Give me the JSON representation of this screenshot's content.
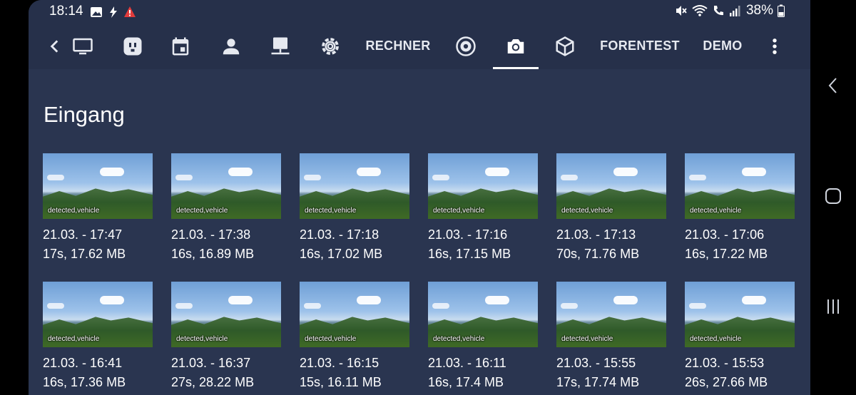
{
  "status": {
    "time": "18:14",
    "battery": "38%"
  },
  "tabs": [
    {
      "label": "",
      "icon": "back-chevron-icon"
    },
    {
      "label": "",
      "icon": "monitor-icon"
    },
    {
      "label": "",
      "icon": "socket-icon"
    },
    {
      "label": "",
      "icon": "calendar-icon"
    },
    {
      "label": "",
      "icon": "person-icon"
    },
    {
      "label": "",
      "icon": "network-icon"
    },
    {
      "label": "",
      "icon": "gear-icon"
    },
    {
      "label": "RECHNER",
      "icon": ""
    },
    {
      "label": "",
      "icon": "camera-dome-icon"
    },
    {
      "label": "",
      "icon": "camera-icon"
    },
    {
      "label": "",
      "icon": "box-icon"
    },
    {
      "label": "FORENTEST",
      "icon": ""
    },
    {
      "label": "DEMO",
      "icon": ""
    },
    {
      "label": "",
      "icon": "more-vertical-icon"
    }
  ],
  "section": {
    "title": "Eingang"
  },
  "recordings": [
    {
      "tag": "detected,vehicle",
      "time": "21.03. - 17:47",
      "info": "17s, 17.62 MB"
    },
    {
      "tag": "detected,vehicle",
      "time": "21.03. - 17:38",
      "info": "16s, 16.89 MB"
    },
    {
      "tag": "detected,vehicle",
      "time": "21.03. - 17:18",
      "info": "16s, 17.02 MB"
    },
    {
      "tag": "detected,vehicle",
      "time": "21.03. - 17:16",
      "info": "16s, 17.15 MB"
    },
    {
      "tag": "detected,vehicle",
      "time": "21.03. - 17:13",
      "info": "70s, 71.76 MB"
    },
    {
      "tag": "detected,vehicle",
      "time": "21.03. - 17:06",
      "info": "16s, 17.22 MB"
    },
    {
      "tag": "detected,vehicle",
      "time": "21.03. - 16:41",
      "info": "16s, 17.36 MB"
    },
    {
      "tag": "detected,vehicle",
      "time": "21.03. - 16:37",
      "info": "27s, 28.22 MB"
    },
    {
      "tag": "detected,vehicle",
      "time": "21.03. - 16:15",
      "info": "15s, 16.11 MB"
    },
    {
      "tag": "detected,vehicle",
      "time": "21.03. - 16:11",
      "info": "16s, 17.4 MB"
    },
    {
      "tag": "detected,vehicle",
      "time": "21.03. - 15:55",
      "info": "17s, 17.74 MB"
    },
    {
      "tag": "detected,vehicle",
      "time": "21.03. - 15:53",
      "info": "26s, 27.66 MB"
    }
  ],
  "colors": {
    "background": "#2a3550",
    "topbar": "#26304a",
    "text": "#ffffff"
  }
}
